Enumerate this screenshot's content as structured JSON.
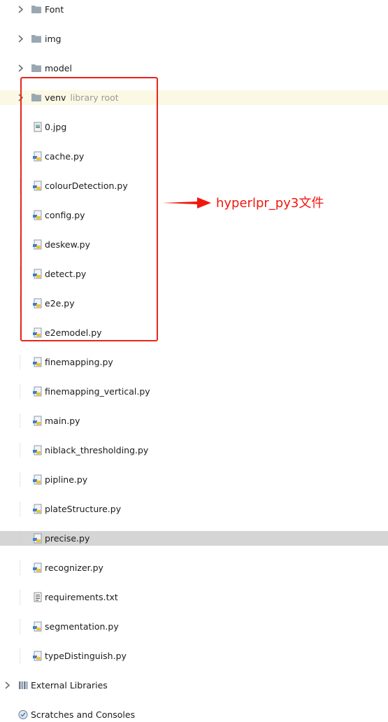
{
  "tree": {
    "folders": [
      {
        "label": "Font"
      },
      {
        "label": "img"
      },
      {
        "label": "model"
      },
      {
        "label": "venv",
        "suffix": "library root"
      }
    ],
    "files": [
      {
        "label": "0.jpg"
      },
      {
        "label": "cache.py"
      },
      {
        "label": "colourDetection.py"
      },
      {
        "label": "config.py"
      },
      {
        "label": "deskew.py"
      },
      {
        "label": "detect.py"
      },
      {
        "label": "e2e.py"
      },
      {
        "label": "e2emodel.py"
      },
      {
        "label": "finemapping.py"
      },
      {
        "label": "finemapping_vertical.py"
      },
      {
        "label": "main.py"
      },
      {
        "label": "niblack_thresholding.py"
      },
      {
        "label": "pipline.py"
      },
      {
        "label": "plateStructure.py"
      },
      {
        "label": "precise.py"
      },
      {
        "label": "recognizer.py"
      },
      {
        "label": "requirements.txt"
      },
      {
        "label": "segmentation.py"
      },
      {
        "label": "typeDistinguish.py"
      }
    ],
    "roots": [
      {
        "label": "External Libraries"
      },
      {
        "label": "Scratches and Consoles"
      }
    ],
    "selected_item": "precise.py"
  },
  "annotation": {
    "text": "hyperlpr_py3文件",
    "color": "#f0180f"
  }
}
